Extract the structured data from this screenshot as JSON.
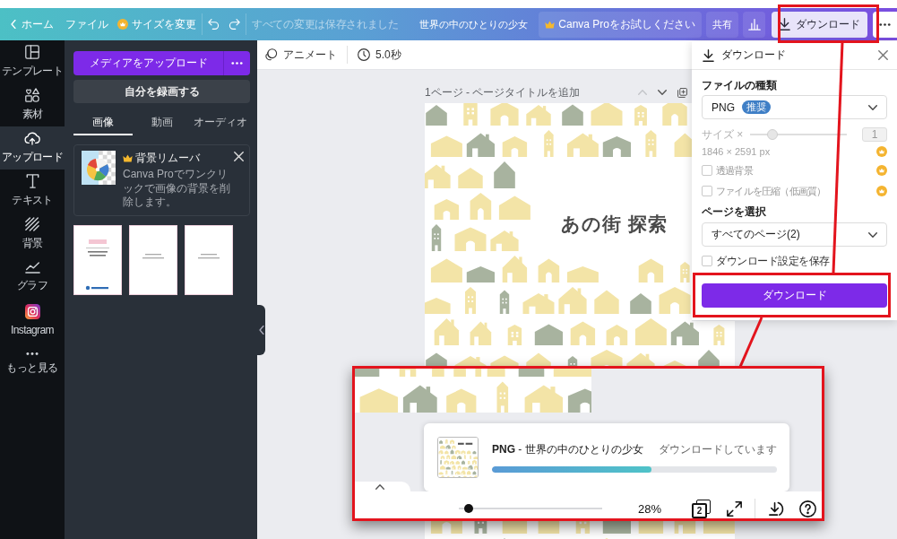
{
  "top_bar": {
    "home": "ホーム",
    "file_menu": "ファイル",
    "resize": "サイズを変更",
    "save_status": "すべての変更は保存されました",
    "design_title": "世界の中のひとりの少女",
    "pro_button": "Canva Proをお試しください",
    "share_button": "共有",
    "download_button": "ダウンロード"
  },
  "side_nav": [
    {
      "label": "テンプレート",
      "selected": false
    },
    {
      "label": "素材",
      "selected": false
    },
    {
      "label": "アップロード",
      "selected": true
    },
    {
      "label": "テキスト",
      "selected": false
    },
    {
      "label": "背景",
      "selected": false
    },
    {
      "label": "グラフ",
      "selected": false
    },
    {
      "label": "Instagram",
      "selected": false
    },
    {
      "label": "もっと見る",
      "selected": false
    }
  ],
  "upload_panel": {
    "upload_button": "メディアをアップロード",
    "record_button": "自分を録画する",
    "tabs": [
      {
        "label": "画像",
        "selected": true
      },
      {
        "label": "動画",
        "selected": false
      },
      {
        "label": "オーディオ",
        "selected": false
      }
    ],
    "promo": {
      "title": "背景リムーバ",
      "text": "Canva Proでワンクリックで画像の背景を削除します。"
    },
    "uploads": [
      {
        "kind": "cover"
      },
      {
        "kind": "plain"
      },
      {
        "kind": "plain"
      }
    ]
  },
  "canvas": {
    "toolbar": {
      "animate": "アニメート",
      "duration": "5.0秒"
    },
    "page_label": "1ページ - ページタイトルを追加",
    "page_title": "あの街 探索"
  },
  "download_panel": {
    "title": "ダウンロード",
    "file_type_label": "ファイルの種類",
    "file_type": "PNG",
    "file_type_badge": "推奨",
    "size": {
      "label": "サイズ ×",
      "level": 0.2,
      "value": "1",
      "disabled": true
    },
    "dimensions": {
      "text": "1846 × 2591 px",
      "pro": true
    },
    "options": [
      {
        "label": "透過背景",
        "checked": false,
        "disabled": true,
        "pro": true
      },
      {
        "label": "ファイルを圧縮（低画質）",
        "checked": false,
        "disabled": true,
        "pro": true
      }
    ],
    "pages_label": "ページを選択",
    "pages": "すべてのページ(2)",
    "save_settings": {
      "label": "ダウンロード設定を保存",
      "checked": false
    },
    "download_button": "ダウンロード"
  },
  "callout": {
    "toast": {
      "file": "**PNG** - 世界の中のひとりの少女",
      "status": "ダウンロードしています",
      "level": 0.56
    },
    "zoom": {
      "level": 0.04,
      "value": "28%"
    },
    "page_count": "2"
  }
}
